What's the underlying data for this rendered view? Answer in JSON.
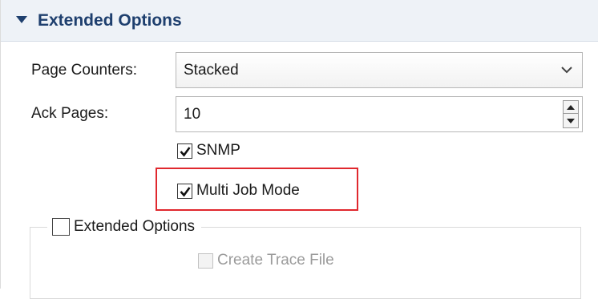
{
  "section": {
    "title": "Extended Options",
    "icon": "expand-triangle-icon"
  },
  "fields": {
    "page_counters": {
      "label": "Page Counters:",
      "value": "Stacked",
      "icon": "chevron-down-icon"
    },
    "ack_pages": {
      "label": "Ack Pages:",
      "value": "10"
    }
  },
  "checkboxes": {
    "snmp": {
      "label": "SNMP",
      "checked": true
    },
    "multi_job_mode": {
      "label": "Multi Job Mode",
      "checked": true
    },
    "extended_options": {
      "label": "Extended Options",
      "checked": false
    },
    "create_trace_file": {
      "label": "Create Trace File",
      "checked": false,
      "disabled": true
    }
  },
  "colors": {
    "header_bg": "#eef2f7",
    "header_text": "#1e3f6e",
    "highlight": "#e0282e"
  }
}
